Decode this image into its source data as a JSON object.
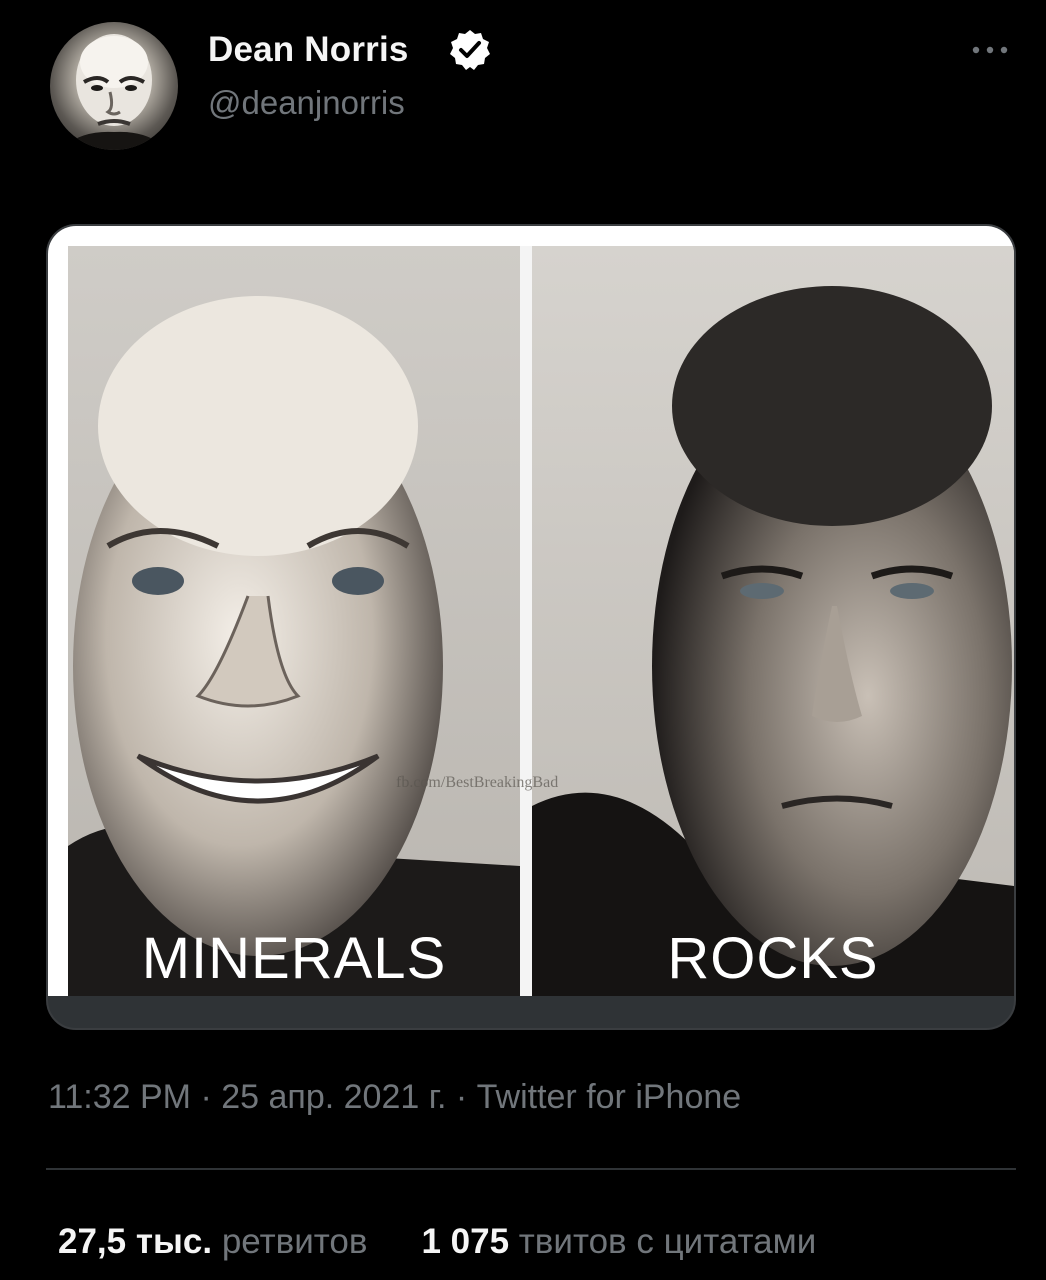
{
  "tweet": {
    "author": {
      "display_name": "Dean Norris",
      "handle": "@deanjnorris",
      "verified": true,
      "verified_color": "#ffffff"
    },
    "more_icon": "ellipsis-icon",
    "media": {
      "left_caption": "MINERALS",
      "right_caption": "ROCKS",
      "watermark": "fb.com/BestBreakingBad"
    },
    "meta": {
      "time": "11:32 PM",
      "separator": " · ",
      "date": "25 апр. 2021 г.",
      "source": "Twitter for iPhone"
    },
    "stats": {
      "retweets_count": "27,5 тыс.",
      "retweets_label": "ретвитов",
      "quotes_count": "1 075",
      "quotes_label": "твитов с цитатами"
    }
  }
}
